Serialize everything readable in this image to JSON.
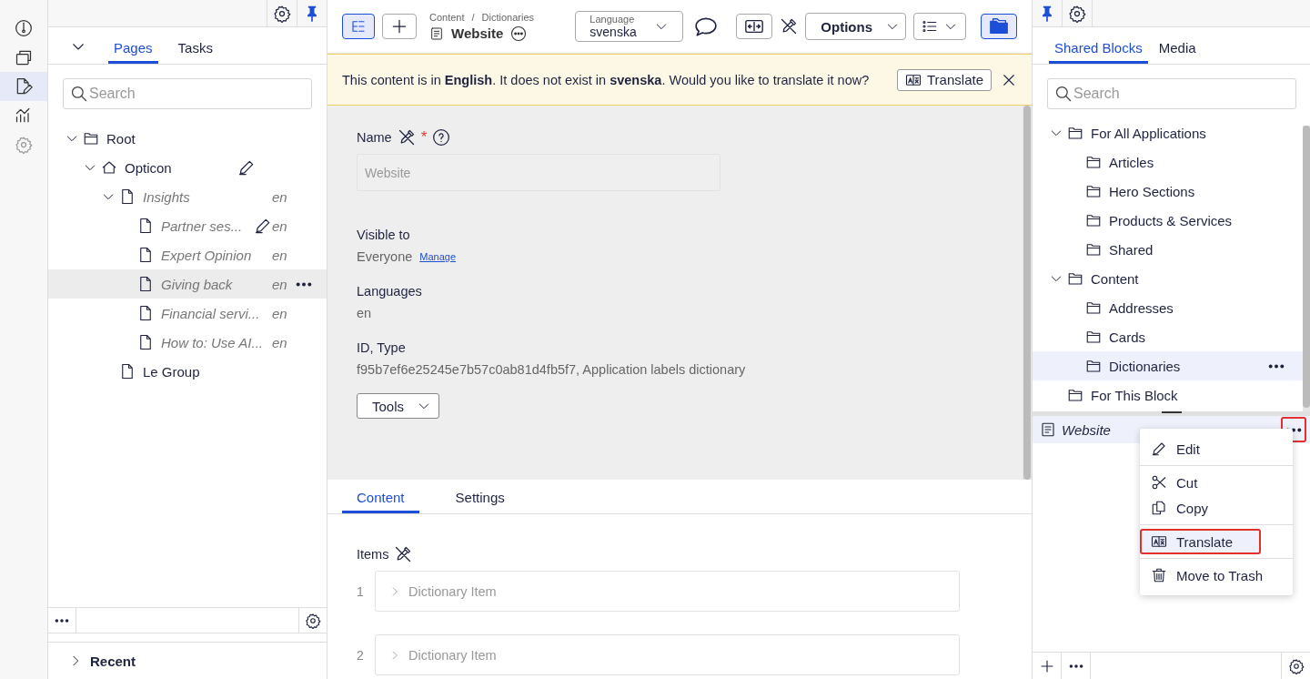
{
  "rail": {
    "items": [
      {
        "kind": "dashboard",
        "selected": false
      },
      {
        "kind": "stack",
        "selected": false
      },
      {
        "kind": "edit",
        "selected": true
      },
      {
        "kind": "chart",
        "selected": false
      },
      {
        "kind": "settings",
        "selected": false
      }
    ]
  },
  "left_panel": {
    "tabs": [
      {
        "label": "Pages",
        "selected": true
      },
      {
        "label": "Tasks",
        "selected": false
      }
    ],
    "search": {
      "placeholder": "Search"
    },
    "tree": [
      {
        "label": "Root",
        "kind": "folder",
        "expanded": true,
        "selected": false,
        "dimmed": false,
        "children": [
          {
            "label": "Opticon",
            "kind": "home",
            "expanded": true,
            "selected": false,
            "dimmed": false,
            "editing": true,
            "children": [
              {
                "label": "Insights",
                "kind": "page",
                "expanded": true,
                "selected": false,
                "dimmed": true,
                "language": "en",
                "children": [
                  {
                    "label": "Partner ses...",
                    "kind": "page",
                    "selected": false,
                    "dimmed": true,
                    "editing": true,
                    "language": "en"
                  },
                  {
                    "label": "Expert Opinion",
                    "kind": "page",
                    "selected": false,
                    "dimmed": true,
                    "language": "en"
                  },
                  {
                    "label": "Giving back",
                    "kind": "page",
                    "selected": true,
                    "dimmed": true,
                    "language": "en"
                  },
                  {
                    "label": "Financial servi...",
                    "kind": "page",
                    "selected": false,
                    "dimmed": true,
                    "language": "en"
                  },
                  {
                    "label": "How to: Use AI...",
                    "kind": "page",
                    "selected": false,
                    "dimmed": true,
                    "language": "en"
                  }
                ]
              },
              {
                "label": "Le Group",
                "kind": "page",
                "selected": false,
                "dimmed": false
              }
            ]
          }
        ]
      }
    ],
    "recent": {
      "label": "Recent",
      "expanded": false
    }
  },
  "editor": {
    "breadcrumb": [
      "Content",
      "Dictionaries"
    ],
    "separator": "/",
    "title": "Website",
    "language": {
      "label": "Language",
      "value": "svenska"
    },
    "options": "Options",
    "notice": {
      "text": "This content is in **English**. It does not exist in **svenska**. Would you like to translate it now?",
      "button": "Translate"
    },
    "fields": {
      "name": {
        "label": "Name",
        "required_mark": "*",
        "value": "Website"
      },
      "visible_to": {
        "label": "Visible to",
        "value": "Everyone",
        "link": "Manage"
      },
      "languages": {
        "label": "Languages",
        "value": "en"
      },
      "id_type": {
        "label": "ID, Type",
        "value": "f95b7ef6e25245e7b57c0ab81d4fb5f7, Application labels dictionary"
      },
      "tools": "Tools"
    },
    "tabs": [
      {
        "label": "Content",
        "selected": true
      },
      {
        "label": "Settings",
        "selected": false
      }
    ],
    "items": {
      "label": "Items",
      "list": [
        {
          "number": "1",
          "label": "Dictionary Item"
        },
        {
          "number": "2",
          "label": "Dictionary Item"
        }
      ]
    }
  },
  "assets_panel": {
    "tabs": [
      {
        "label": "Shared Blocks",
        "selected": true
      },
      {
        "label": "Media",
        "selected": false
      }
    ],
    "search": {
      "placeholder": "Search"
    },
    "tree": [
      {
        "label": "For All Applications",
        "expanded": true,
        "selected": false,
        "children": [
          {
            "label": "Articles",
            "selected": false
          },
          {
            "label": "Hero Sections",
            "selected": false
          },
          {
            "label": "Products & Services",
            "selected": false
          },
          {
            "label": "Shared",
            "selected": false
          }
        ]
      },
      {
        "label": "Content",
        "expanded": true,
        "selected": false,
        "children": [
          {
            "label": "Addresses",
            "selected": false
          },
          {
            "label": "Cards",
            "selected": false
          },
          {
            "label": "Dictionaries",
            "selected": true
          }
        ]
      },
      {
        "label": "For This Block",
        "selected": false
      }
    ],
    "blocks": [
      {
        "label": "Website",
        "selected": true,
        "outlined": true
      }
    ],
    "context_menu": [
      [
        {
          "kind": "edit",
          "label": "Edit",
          "selected": false,
          "outlined": false
        }
      ],
      [
        {
          "kind": "cut",
          "label": "Cut",
          "selected": false,
          "outlined": false
        },
        {
          "kind": "copy",
          "label": "Copy",
          "selected": false,
          "outlined": false
        }
      ],
      [
        {
          "kind": "translate",
          "label": "Translate",
          "selected": true,
          "outlined": true
        }
      ],
      [
        {
          "kind": "trash",
          "label": "Move to Trash",
          "selected": false,
          "outlined": false
        }
      ]
    ]
  }
}
